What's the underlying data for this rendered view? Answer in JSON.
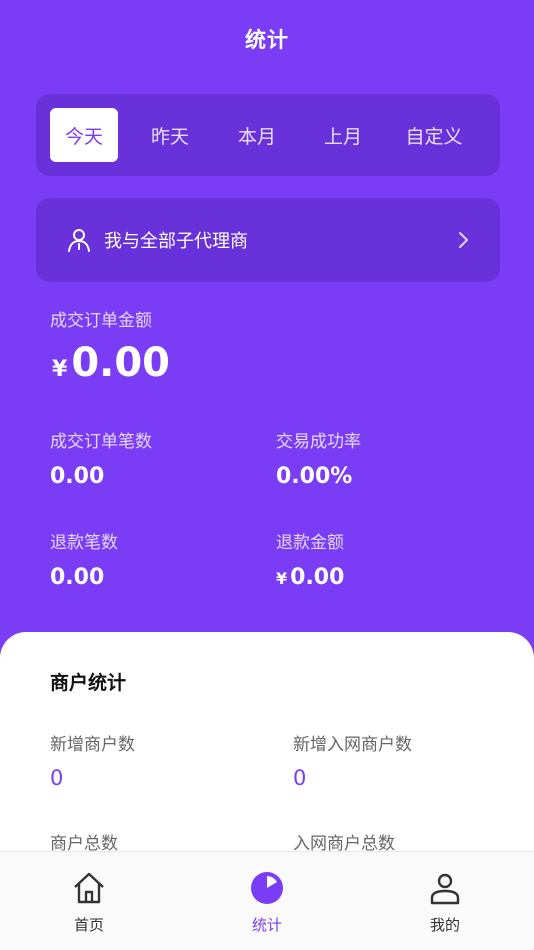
{
  "header": {
    "title": "统计"
  },
  "tabs": [
    {
      "label": "今天",
      "active": true
    },
    {
      "label": "昨天",
      "active": false
    },
    {
      "label": "本月",
      "active": false
    },
    {
      "label": "上月",
      "active": false
    },
    {
      "label": "自定义",
      "active": false
    }
  ],
  "agent_filter": {
    "label": "我与全部子代理商",
    "icon": "person-icon"
  },
  "summary": {
    "order_amount_label": "成交订单金额",
    "currency": "¥",
    "order_amount": "0.00",
    "order_count_label": "成交订单笔数",
    "order_count": "0.00",
    "success_rate_label": "交易成功率",
    "success_rate": "0.00%",
    "refund_count_label": "退款笔数",
    "refund_count": "0.00",
    "refund_amount_label": "退款金额",
    "refund_amount": "0.00"
  },
  "merchant_stats": {
    "title": "商户统计",
    "new_merchants_label": "新增商户数",
    "new_merchants": "0",
    "new_network_merchants_label": "新增入网商户数",
    "new_network_merchants": "0",
    "total_merchants_label": "商户总数",
    "total_network_merchants_label": "入网商户总数"
  },
  "bottom_nav": [
    {
      "label": "首页",
      "icon": "home-icon",
      "active": false
    },
    {
      "label": "统计",
      "icon": "pie-chart-icon",
      "active": true
    },
    {
      "label": "我的",
      "icon": "user-icon",
      "active": false
    }
  ],
  "colors": {
    "primary": "#7B3CF5",
    "card_bg": "#FFFFFF"
  }
}
